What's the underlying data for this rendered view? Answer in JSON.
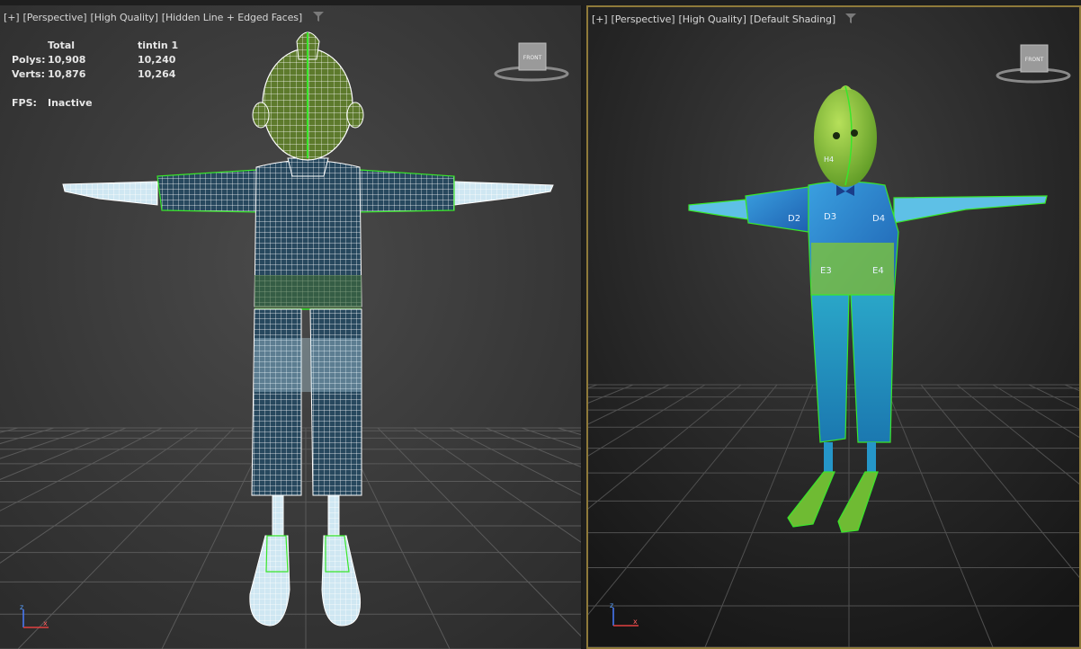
{
  "left_viewport": {
    "labels": [
      "[+]",
      "[Perspective]",
      "[High Quality]",
      "[Hidden Line + Edged Faces]"
    ],
    "stats": {
      "header": [
        "",
        "Total",
        "tintin 1"
      ],
      "rows": [
        {
          "label": "Polys:",
          "total": "10,908",
          "object": "10,240"
        },
        {
          "label": "Verts:",
          "total": "10,876",
          "object": "10,264"
        }
      ],
      "fps_label": "FPS:",
      "fps_value": "Inactive"
    },
    "viewcube_label": "FRONT"
  },
  "right_viewport": {
    "labels": [
      "[+]",
      "[Perspective]",
      "[High Quality]",
      "[Default Shading]"
    ],
    "viewcube_label": "FRONT",
    "uv_labels": [
      "D2",
      "D3",
      "D4",
      "E3",
      "E4",
      "H4"
    ],
    "active_border_color": "#8f7a3a"
  },
  "axis": {
    "z": "z",
    "x": "x"
  },
  "colors": {
    "wireframe": "#ffffff",
    "selection": "#39e62b",
    "shirt": "#2277cc",
    "skin": "#86c23a"
  }
}
